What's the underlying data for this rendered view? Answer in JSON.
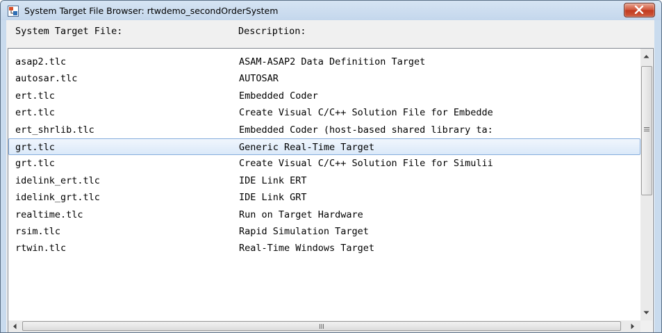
{
  "window": {
    "title": "System Target File Browser: rtwdemo_secondOrderSystem"
  },
  "columns": {
    "file_header": "System Target File:",
    "description_header": "Description:"
  },
  "rows": [
    {
      "file": "asap2.tlc",
      "description": "ASAM-ASAP2 Data Definition Target"
    },
    {
      "file": "autosar.tlc",
      "description": "AUTOSAR"
    },
    {
      "file": "ert.tlc",
      "description": "Embedded Coder"
    },
    {
      "file": "ert.tlc",
      "description": "Create Visual C/C++ Solution File for Embedde"
    },
    {
      "file": "ert_shrlib.tlc",
      "description": "Embedded Coder (host-based shared library ta:"
    },
    {
      "file": "grt.tlc",
      "description": "Generic Real-Time Target"
    },
    {
      "file": "grt.tlc",
      "description": "Create Visual C/C++ Solution File for Simulii"
    },
    {
      "file": "idelink_ert.tlc",
      "description": "IDE Link ERT"
    },
    {
      "file": "idelink_grt.tlc",
      "description": "IDE Link GRT"
    },
    {
      "file": "realtime.tlc",
      "description": "Run on Target Hardware"
    },
    {
      "file": "rsim.tlc",
      "description": "Rapid Simulation Target"
    },
    {
      "file": "rtwin.tlc",
      "description": "Real-Time Windows Target"
    }
  ],
  "selected_row_index": 5,
  "icons": {
    "app": "simulink-app-icon",
    "close": "close-icon",
    "scroll_up": "arrow-up-icon",
    "scroll_down": "arrow-down-icon",
    "scroll_left": "arrow-left-icon",
    "scroll_right": "arrow-right-icon",
    "vertical_grip": "scroll-grip-icon",
    "horizontal_grip": "scroll-grip-icon"
  },
  "colors": {
    "selection_border": "#84acdd",
    "selection_fill": "#dbe9f9",
    "close_button": "#c13a1f",
    "titlebar": "#c9dbee"
  }
}
